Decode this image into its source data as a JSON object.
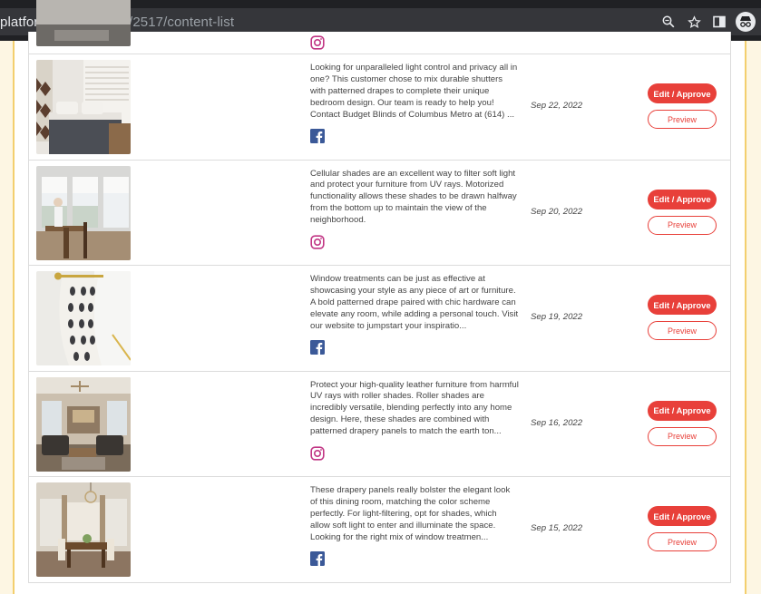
{
  "browser": {
    "url_host": "platform.com",
    "url_path": "/content/2517/content-list"
  },
  "colors": {
    "accent": "#e8403a",
    "facebook": "#3b5998",
    "instagram": "#c13584"
  },
  "buttons": {
    "edit_label": "Edit / Approve",
    "preview_label": "Preview"
  },
  "rows": [
    {
      "social": "facebook-icon",
      "description": "Looking for unparalleled light control and privacy all in one? This customer chose to mix durable shutters with patterned drapes to complete their unique bedroom design. Our team is ready to help you! Contact Budget Blinds of Columbus Metro at (614) ...",
      "date": "Sep 22, 2022"
    },
    {
      "social": "instagram-icon",
      "description": "Cellular shades are an excellent way to filter soft light and protect your furniture from UV rays. Motorized functionality allows these shades to be drawn halfway from the bottom up to maintain the view of the neighborhood.",
      "date": "Sep 20, 2022"
    },
    {
      "social": "facebook-icon",
      "description": "Window treatments can be just as effective at showcasing your style as any piece of art or furniture. A bold patterned drape paired with chic hardware can elevate any room, while adding a personal touch. Visit our website to jumpstart your inspiratio...",
      "date": "Sep 19, 2022"
    },
    {
      "social": "instagram-icon",
      "description": "Protect your high-quality leather furniture from harmful UV rays with roller shades. Roller shades are incredibly versatile, blending perfectly into any home design. Here, these shades are combined with patterned drapery panels to match the earth ton...",
      "date": "Sep 16, 2022"
    },
    {
      "social": "facebook-icon",
      "description": "These drapery panels really bolster the elegant look of this dining room, matching the color scheme perfectly. For light-filtering, opt for shades, which allow soft light to enter and illuminate the space. Looking for the right mix of window treatmen...",
      "date": "Sep 15, 2022"
    }
  ]
}
